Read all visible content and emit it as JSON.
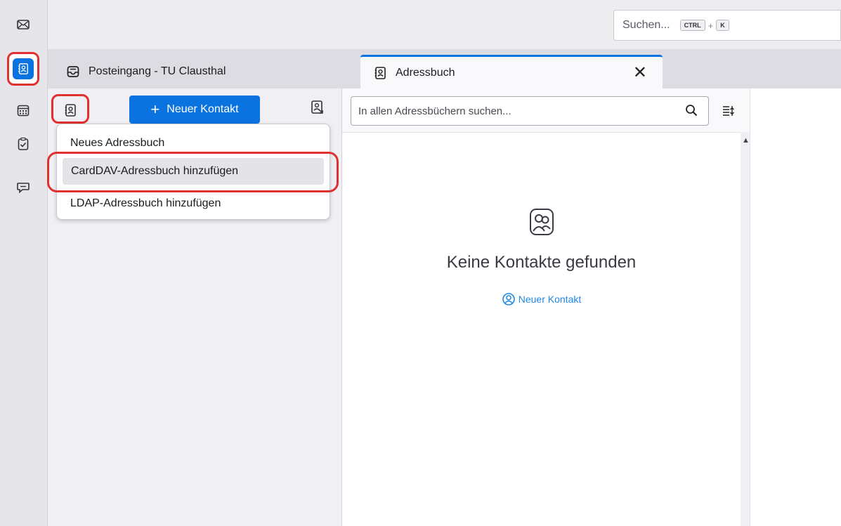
{
  "spaces": {
    "items": [
      {
        "name": "mail",
        "icon": "mail-icon"
      },
      {
        "name": "address-book",
        "icon": "address-book-icon",
        "active": true
      },
      {
        "name": "calendar",
        "icon": "calendar-icon"
      },
      {
        "name": "tasks",
        "icon": "tasks-icon"
      },
      {
        "name": "chat",
        "icon": "chat-icon"
      }
    ]
  },
  "search": {
    "placeholder": "Suchen...",
    "shortcut_ctrl": "CTRL",
    "shortcut_plus": "+",
    "shortcut_key": "K"
  },
  "tabs": [
    {
      "label": "Posteingang - TU Clausthal",
      "icon": "inbox-icon",
      "active": false
    },
    {
      "label": "Adressbuch",
      "icon": "address-book-icon",
      "active": true
    }
  ],
  "tab_close": "✕",
  "toolbar": {
    "new_contact_plus": "+",
    "new_contact_label": "Neuer Kontakt"
  },
  "menu": {
    "items": [
      {
        "label": "Neues Adressbuch"
      },
      {
        "label": "CardDAV-Adressbuch hinzufügen",
        "highlighted": true
      },
      {
        "label": "LDAP-Adressbuch hinzufügen"
      }
    ]
  },
  "card_search": {
    "placeholder": "In allen Adressbüchern suchen..."
  },
  "empty_state": {
    "title": "Keine Kontakte gefunden",
    "link": "Neuer Kontakt"
  },
  "colors": {
    "accent": "#0b73e0",
    "highlight_annotation": "#e0302f",
    "link": "#1e88e5"
  }
}
